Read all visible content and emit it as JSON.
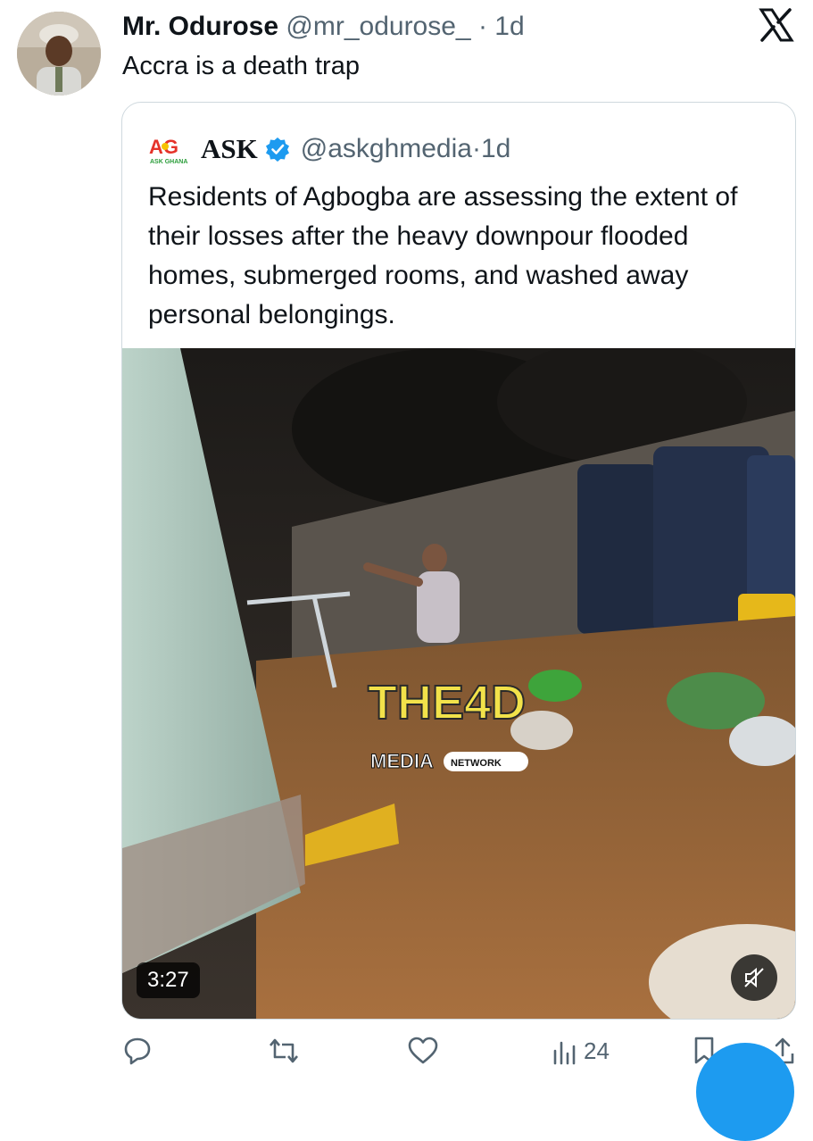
{
  "tweet": {
    "author_name": "Mr. Odurose",
    "author_handle": "@mr_odurose_",
    "separator": "·",
    "time": "1d",
    "text": "Accra is a death trap"
  },
  "quoted": {
    "logo_text": "AG",
    "logo_subtext": "ASK GHANA",
    "author_name": "ASK",
    "verified": true,
    "author_handle": "@askghmedia",
    "separator": "·",
    "time": "1d",
    "text": "Residents of Agbogba are assessing the extent of their losses after the heavy downpour flooded homes, submerged rooms, and washed away personal belongings.",
    "video": {
      "duration": "3:27",
      "watermark_big": "THE4D",
      "watermark_small": "MEDIA",
      "watermark_badge": "NETWORK",
      "muted": true
    }
  },
  "actions": {
    "reply_icon": "reply-icon",
    "retweet_icon": "retweet-icon",
    "like_icon": "like-icon",
    "views_icon": "views-icon",
    "views_count": "24",
    "bookmark_icon": "bookmark-icon",
    "share_icon": "share-icon"
  },
  "colors": {
    "accent": "#1d9bf0",
    "text_primary": "#0f1419",
    "text_secondary": "#536471",
    "border": "#cfd9de"
  }
}
